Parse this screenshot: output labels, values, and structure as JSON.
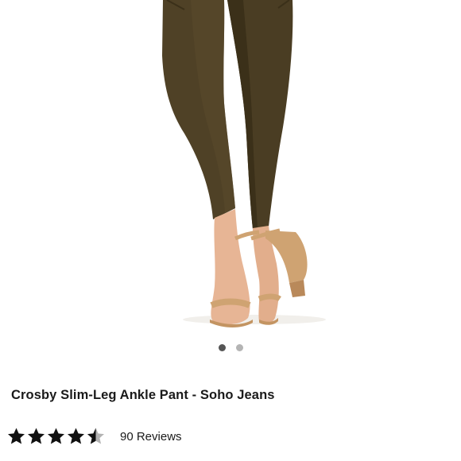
{
  "product": {
    "title": "Crosby Slim-Leg Ankle Pant - Soho Jeans",
    "image": {
      "subject": "olive-pants-with-cork-heels",
      "colors": {
        "pant": "#4f4126",
        "pant_shadow": "#3b3019",
        "skin": "#e7b595",
        "cork": "#cfa372"
      }
    },
    "gallery": {
      "total": 2,
      "current": 1
    },
    "rating": {
      "value": 4.5,
      "max": 5,
      "review_count_label": "90 Reviews"
    }
  },
  "colors": {
    "text": "#1a1a1a",
    "star_filled": "#111111",
    "star_empty": "#b3b3b3",
    "dot_active": "#555555",
    "dot_inactive": "#b4b4b4"
  }
}
